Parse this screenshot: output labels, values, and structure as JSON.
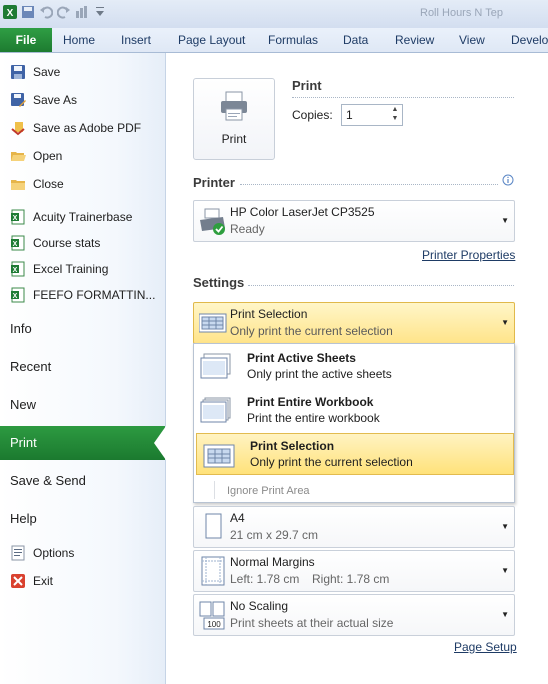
{
  "title_bar": {
    "title": "Roll Hours N Tep"
  },
  "ribbon": {
    "file_tab": "File",
    "tabs": [
      "Home",
      "Insert",
      "Page Layout",
      "Formulas",
      "Data",
      "Review",
      "View",
      "Develo"
    ]
  },
  "sidebar": {
    "commands": [
      {
        "label": "Save",
        "icon": "save-icon"
      },
      {
        "label": "Save As",
        "icon": "save-as-icon"
      },
      {
        "label": "Save as Adobe PDF",
        "icon": "adobe-pdf-icon"
      },
      {
        "label": "Open",
        "icon": "open-folder-icon"
      },
      {
        "label": "Close",
        "icon": "close-folder-icon"
      }
    ],
    "recent_files": [
      {
        "label": "Acuity Trainerbase",
        "icon": "excel-file-icon"
      },
      {
        "label": "Course stats",
        "icon": "excel-file-icon"
      },
      {
        "label": "Excel Training",
        "icon": "excel-file-icon"
      },
      {
        "label": "FEEFO FORMATTIN...",
        "icon": "excel-file-icon"
      }
    ],
    "sections": [
      "Info",
      "Recent",
      "New",
      "Print",
      "Save & Send",
      "Help"
    ],
    "selected_section": "Print",
    "footer": [
      {
        "label": "Options",
        "icon": "options-icon"
      },
      {
        "label": "Exit",
        "icon": "exit-icon"
      }
    ]
  },
  "print": {
    "heading": "Print",
    "button_label": "Print",
    "copies_label": "Copies:",
    "copies_value": "1"
  },
  "printer": {
    "heading": "Printer",
    "name": "HP Color LaserJet CP3525",
    "status": "Ready",
    "properties_link": "Printer Properties"
  },
  "settings": {
    "heading": "Settings",
    "current": {
      "title": "Print Selection",
      "subtitle": "Only print the current selection"
    },
    "dropdown": [
      {
        "title": "Print Active Sheets",
        "subtitle": "Only print the active sheets"
      },
      {
        "title": "Print Entire Workbook",
        "subtitle": "Print the entire workbook"
      },
      {
        "title": "Print Selection",
        "subtitle": "Only print the current selection"
      }
    ],
    "ignore_print_area": "Ignore Print Area",
    "paper": {
      "title": "A4",
      "subtitle": "21 cm x 29.7 cm"
    },
    "margins": {
      "title": "Normal Margins",
      "left": "Left:  1.78 cm",
      "right": "Right:  1.78 cm"
    },
    "scaling": {
      "title": "No Scaling",
      "subtitle": "Print sheets at their actual size",
      "icon_text": "100"
    },
    "page_setup_link": "Page Setup"
  },
  "colors": {
    "file_green": "#1d7b30",
    "selection_yellow": "#ffe48a",
    "link_blue": "#1e3b65"
  }
}
